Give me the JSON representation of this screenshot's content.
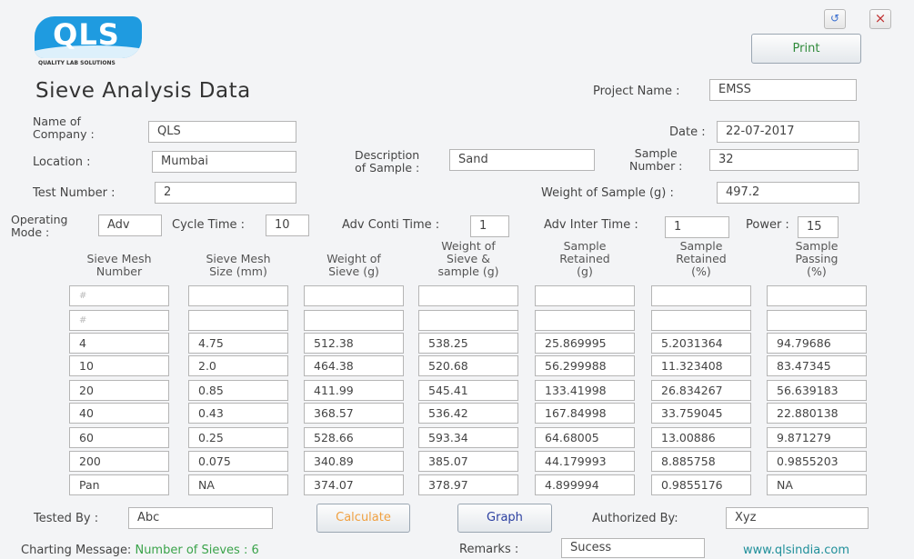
{
  "logo": {
    "text": "QLS",
    "subtitle": "QUALITY LAB SOLUTIONS"
  },
  "window": {
    "restore_glyph": "↺",
    "close_glyph": "×"
  },
  "print_label": "Print",
  "title": "Sieve Analysis Data",
  "form": {
    "project_name_label": "Project Name :",
    "project_name": "EMSS",
    "company_label_l1": "Name of",
    "company_label_l2": "Company :",
    "company": "QLS",
    "date_label": "Date :",
    "date": "22-07-2017",
    "location_label": "Location :",
    "location": "Mumbai",
    "description_label_l1": "Description",
    "description_label_l2": "of Sample :",
    "description": "Sand",
    "sample_number_label_l1": "Sample",
    "sample_number_label_l2": "Number :",
    "sample_number": "32",
    "test_number_label": "Test Number :",
    "test_number": "2",
    "weight_label": "Weight of Sample  (g) :",
    "weight": "497.2",
    "operating_mode_label_l1": "Operating",
    "operating_mode_label_l2": "Mode :",
    "operating_mode": "Adv",
    "cycle_time_label": "Cycle Time :",
    "cycle_time": "10",
    "adv_conti_label": "Adv Conti Time :",
    "adv_conti": "1",
    "adv_inter_label": "Adv Inter Time :",
    "adv_inter": "1",
    "power_label": "Power :",
    "power": "15"
  },
  "table": {
    "headers": [
      [
        "Sieve Mesh",
        "Number"
      ],
      [
        "Sieve Mesh",
        "Size  (mm)"
      ],
      [
        "Weight of",
        "Sieve   (g)"
      ],
      [
        "Weight of",
        "Sieve &",
        "sample  (g)"
      ],
      [
        "Sample",
        "Retained",
        "(g)"
      ],
      [
        "Sample",
        "Retained",
        "(%)"
      ],
      [
        "Sample",
        "Passing",
        "(%)"
      ]
    ],
    "placeholder": "#",
    "rows": [
      [
        "4",
        "4.75",
        "512.38",
        "538.25",
        "25.869995",
        "5.2031364",
        "94.79686"
      ],
      [
        "10",
        "2.0",
        "464.38",
        "520.68",
        "56.299988",
        "11.323408",
        "83.47345"
      ],
      [
        "20",
        "0.85",
        "411.99",
        "545.41",
        "133.41998",
        "26.834267",
        "56.639183"
      ],
      [
        "40",
        "0.43",
        "368.57",
        "536.42",
        "167.84998",
        "33.759045",
        "22.880138"
      ],
      [
        "60",
        "0.25",
        "528.66",
        "593.34",
        "64.68005",
        "13.00886",
        "9.871279"
      ],
      [
        "200",
        "0.075",
        "340.89",
        "385.07",
        "44.179993",
        "8.885758",
        "0.9855203"
      ],
      [
        "Pan",
        "NA",
        "374.07",
        "378.97",
        "4.899994",
        "0.9855176",
        "NA"
      ]
    ]
  },
  "footer": {
    "tested_by_label": "Tested By :",
    "tested_by": "Abc",
    "calculate_label": "Calculate",
    "graph_label": "Graph",
    "authorized_by_label": "Authorized By:",
    "authorized_by": "Xyz",
    "charting_label": "Charting Message:",
    "charting_message": "Number of Sieves : 6",
    "remarks_label": "Remarks :",
    "remarks": "Sucess",
    "website": "www.qlsindia.com"
  },
  "colors": {
    "calculate_text": "#f0a040",
    "graph_text": "#2b3fa0",
    "print_text": "#2f8a3a",
    "message_green": "#3aa34a",
    "link_teal": "#1f8f9a",
    "logo_blue": "#1f9be0"
  }
}
